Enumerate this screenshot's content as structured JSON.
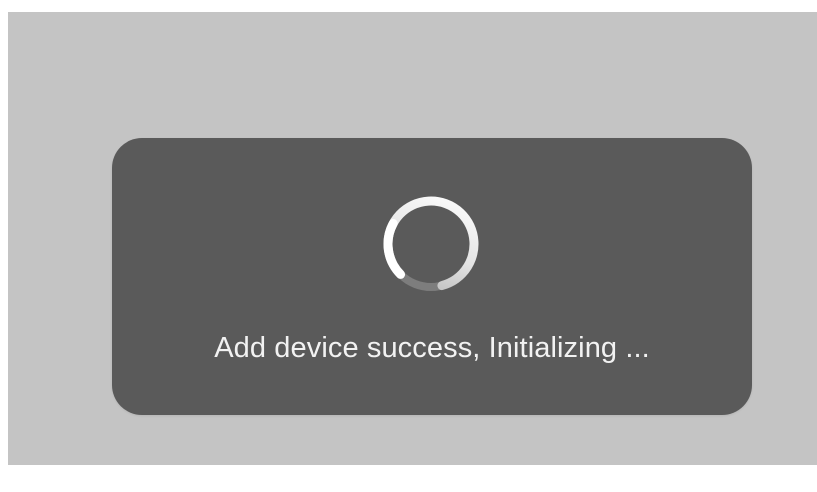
{
  "dialog": {
    "message": "Add device success, Initializing ...",
    "spinner_icon": "loading-spinner-icon"
  },
  "colors": {
    "backdrop": "#c4c4c4",
    "dialog_background": "#5a5a5a",
    "message_text": "#f2f2f2",
    "spinner_track": "#7d7d7d",
    "spinner_arc": "#f0f0f0"
  }
}
